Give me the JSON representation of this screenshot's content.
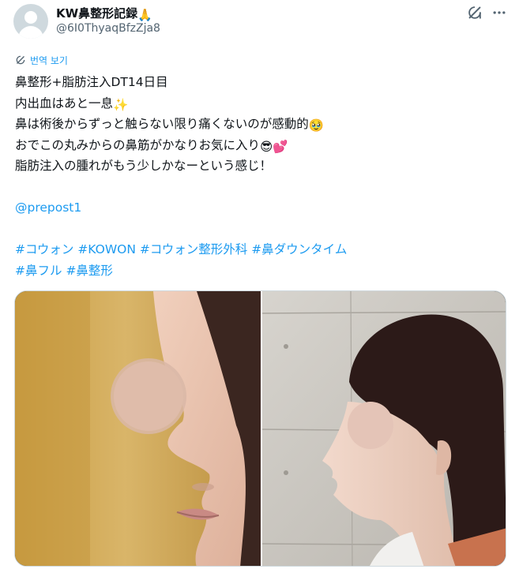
{
  "author": {
    "display_name": "KW鼻整形記録",
    "display_emoji": "🙏",
    "handle": "@6I0ThyaqBfzZja8"
  },
  "actions": {
    "grok_icon": "grok-icon",
    "more_icon": "more-icon"
  },
  "translate": {
    "label": "번역 보기"
  },
  "tweet": {
    "line1": "鼻整形+脂肪注入DT14日目",
    "line2": "内出血はあと一息",
    "line2_emoji": "✨",
    "line3": "鼻は術後からずっと触らない限り痛くないのが感動的",
    "line3_emoji": "🥹",
    "line4": "おでこの丸みからの鼻筋がかなりお気に入り",
    "line4_emoji": "😎💕",
    "line5": "脂肪注入の腫れがもう少しかなーという感じ！",
    "mention": "@prepost1",
    "hashtags_row1": [
      "#コウォン",
      "#KOWON",
      "#コウォン整形外科",
      "#鼻ダウンタイム"
    ],
    "hashtags_row2": [
      "#鼻フル",
      "#鼻整形"
    ]
  },
  "media": {
    "count": 2
  },
  "colors": {
    "link": "#1d9bf0",
    "text": "#0f1419",
    "muted": "#536471",
    "border": "#cfd9de"
  }
}
